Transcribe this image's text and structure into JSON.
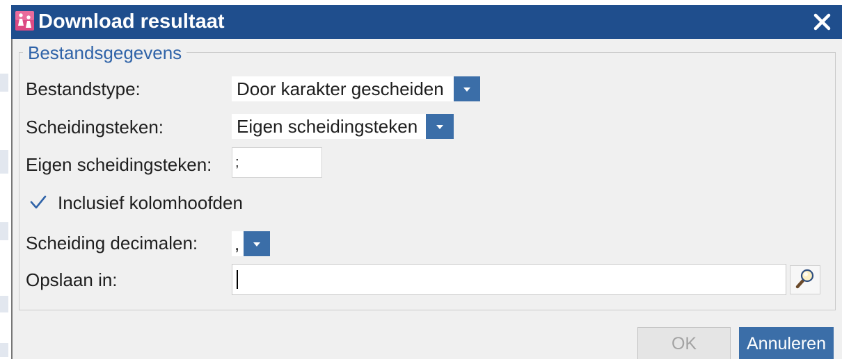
{
  "dialog": {
    "title": "Download resultaat",
    "title_icon": "app-logo-icon",
    "close_icon": "close-icon"
  },
  "form": {
    "legend": "Bestandsgegevens",
    "file_type": {
      "label": "Bestandstype:",
      "value": "Door karakter gescheiden"
    },
    "separator": {
      "label": "Scheidingsteken:",
      "value": "Eigen scheidingsteken"
    },
    "custom_separator": {
      "label": "Eigen scheidingsteken:",
      "value": ";"
    },
    "include_headers": {
      "label": "Inclusief kolomhoofden",
      "checked": true
    },
    "decimal_separator": {
      "label": "Scheiding decimalen:",
      "value": ","
    },
    "save_in": {
      "label": "Opslaan in:",
      "value": ""
    },
    "dropdown_icon": "chevron-down-icon",
    "check_icon": "checkmark-icon",
    "browse_icon": "magnifier-icon"
  },
  "footer": {
    "ok_label": "OK",
    "ok_disabled": true,
    "cancel_label": "Annuleren"
  },
  "colors": {
    "title_bar": "#1f4e8d",
    "accent": "#3b6ea8",
    "legend_text": "#2f63a8",
    "dialog_background": "#f0f0f0"
  }
}
